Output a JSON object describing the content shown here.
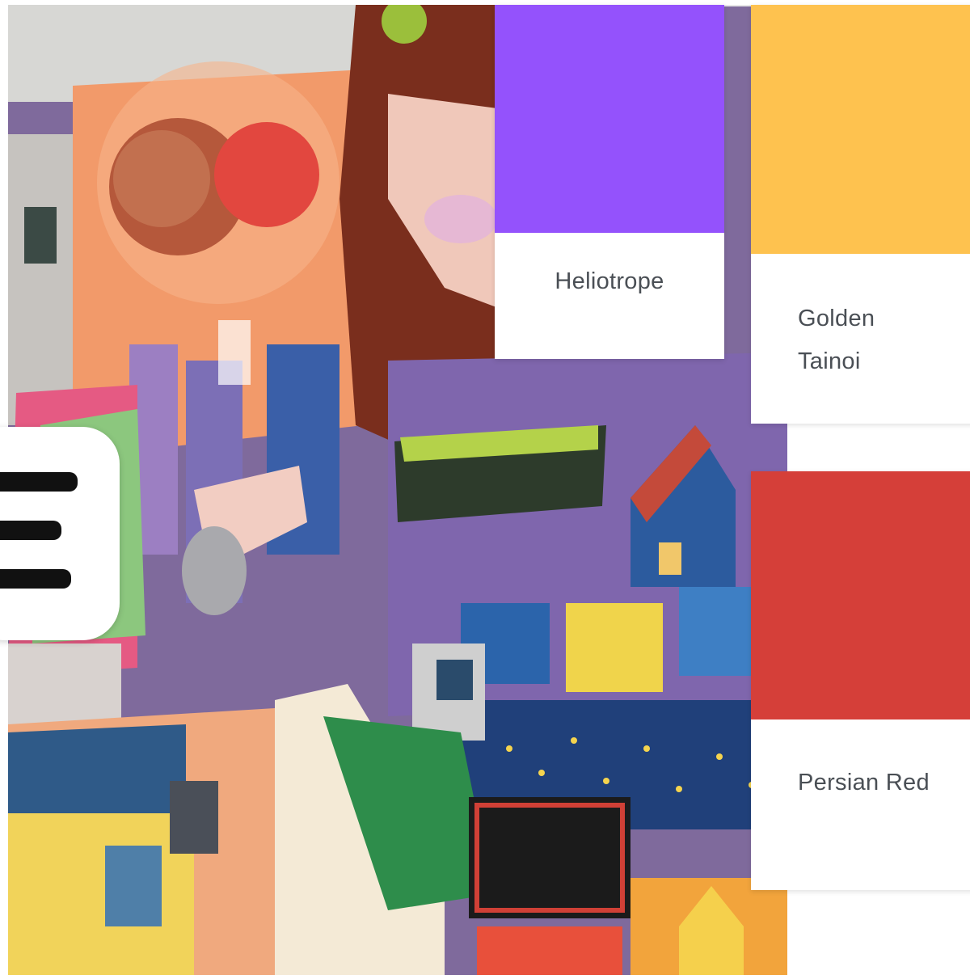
{
  "swatches": [
    {
      "id": "heliotrope",
      "name": "Heliotrope",
      "color": "#9452fc"
    },
    {
      "id": "golden-tainoi",
      "name": "Golden Tainoi",
      "color": "#fec24f"
    },
    {
      "id": "persian-red",
      "name": "Persian Red",
      "color": "#d53f39"
    }
  ],
  "menu": {
    "icon": "menu-icon"
  },
  "photo": {
    "subject": "street-art-mural-image"
  }
}
